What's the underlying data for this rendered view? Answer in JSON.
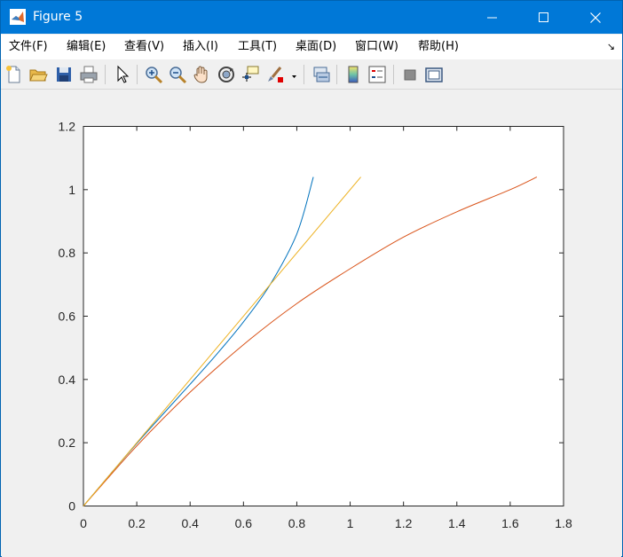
{
  "window": {
    "title": "Figure 5"
  },
  "menu": [
    {
      "label": "文件(F)"
    },
    {
      "label": "编辑(E)"
    },
    {
      "label": "查看(V)"
    },
    {
      "label": "插入(I)"
    },
    {
      "label": "工具(T)"
    },
    {
      "label": "桌面(D)"
    },
    {
      "label": "窗口(W)"
    },
    {
      "label": "帮助(H)"
    }
  ],
  "toolbar_icons": [
    "new-figure-icon",
    "open-folder-icon",
    "save-icon",
    "print-icon",
    "pointer-icon",
    "zoom-in-icon",
    "zoom-out-icon",
    "pan-hand-icon",
    "rotate-3d-icon",
    "data-cursor-icon",
    "brush-icon",
    "link-plot-icon",
    "colorbar-icon",
    "legend-icon",
    "hide-plot-tools-icon",
    "show-plot-tools-icon"
  ],
  "colors": {
    "series1": "#0072bd",
    "series2": "#d95319",
    "series3": "#edb120"
  },
  "chart_data": {
    "type": "line",
    "xlim": [
      0,
      1.8
    ],
    "ylim": [
      0,
      1.2
    ],
    "xticks": [
      "0",
      "0.2",
      "0.4",
      "0.6",
      "0.8",
      "1",
      "1.2",
      "1.4",
      "1.6",
      "1.8"
    ],
    "yticks": [
      "0",
      "0.2",
      "0.4",
      "0.6",
      "0.8",
      "1",
      "1.2"
    ],
    "grid": false,
    "series": [
      {
        "color": "#0072bd",
        "x": [
          0,
          0.1,
          0.2,
          0.3,
          0.4,
          0.5,
          0.6,
          0.7,
          0.8,
          0.862
        ],
        "y": [
          0,
          0.1,
          0.198,
          0.292,
          0.385,
          0.48,
          0.582,
          0.7,
          0.86,
          1.04
        ]
      },
      {
        "color": "#d95319",
        "x": [
          0,
          0.2,
          0.4,
          0.6,
          0.8,
          1.0,
          1.2,
          1.4,
          1.6,
          1.7
        ],
        "y": [
          0,
          0.19,
          0.36,
          0.51,
          0.64,
          0.75,
          0.85,
          0.93,
          1.0,
          1.04
        ]
      },
      {
        "color": "#edb120",
        "x": [
          0,
          1.04
        ],
        "y": [
          0,
          1.04
        ]
      }
    ]
  }
}
